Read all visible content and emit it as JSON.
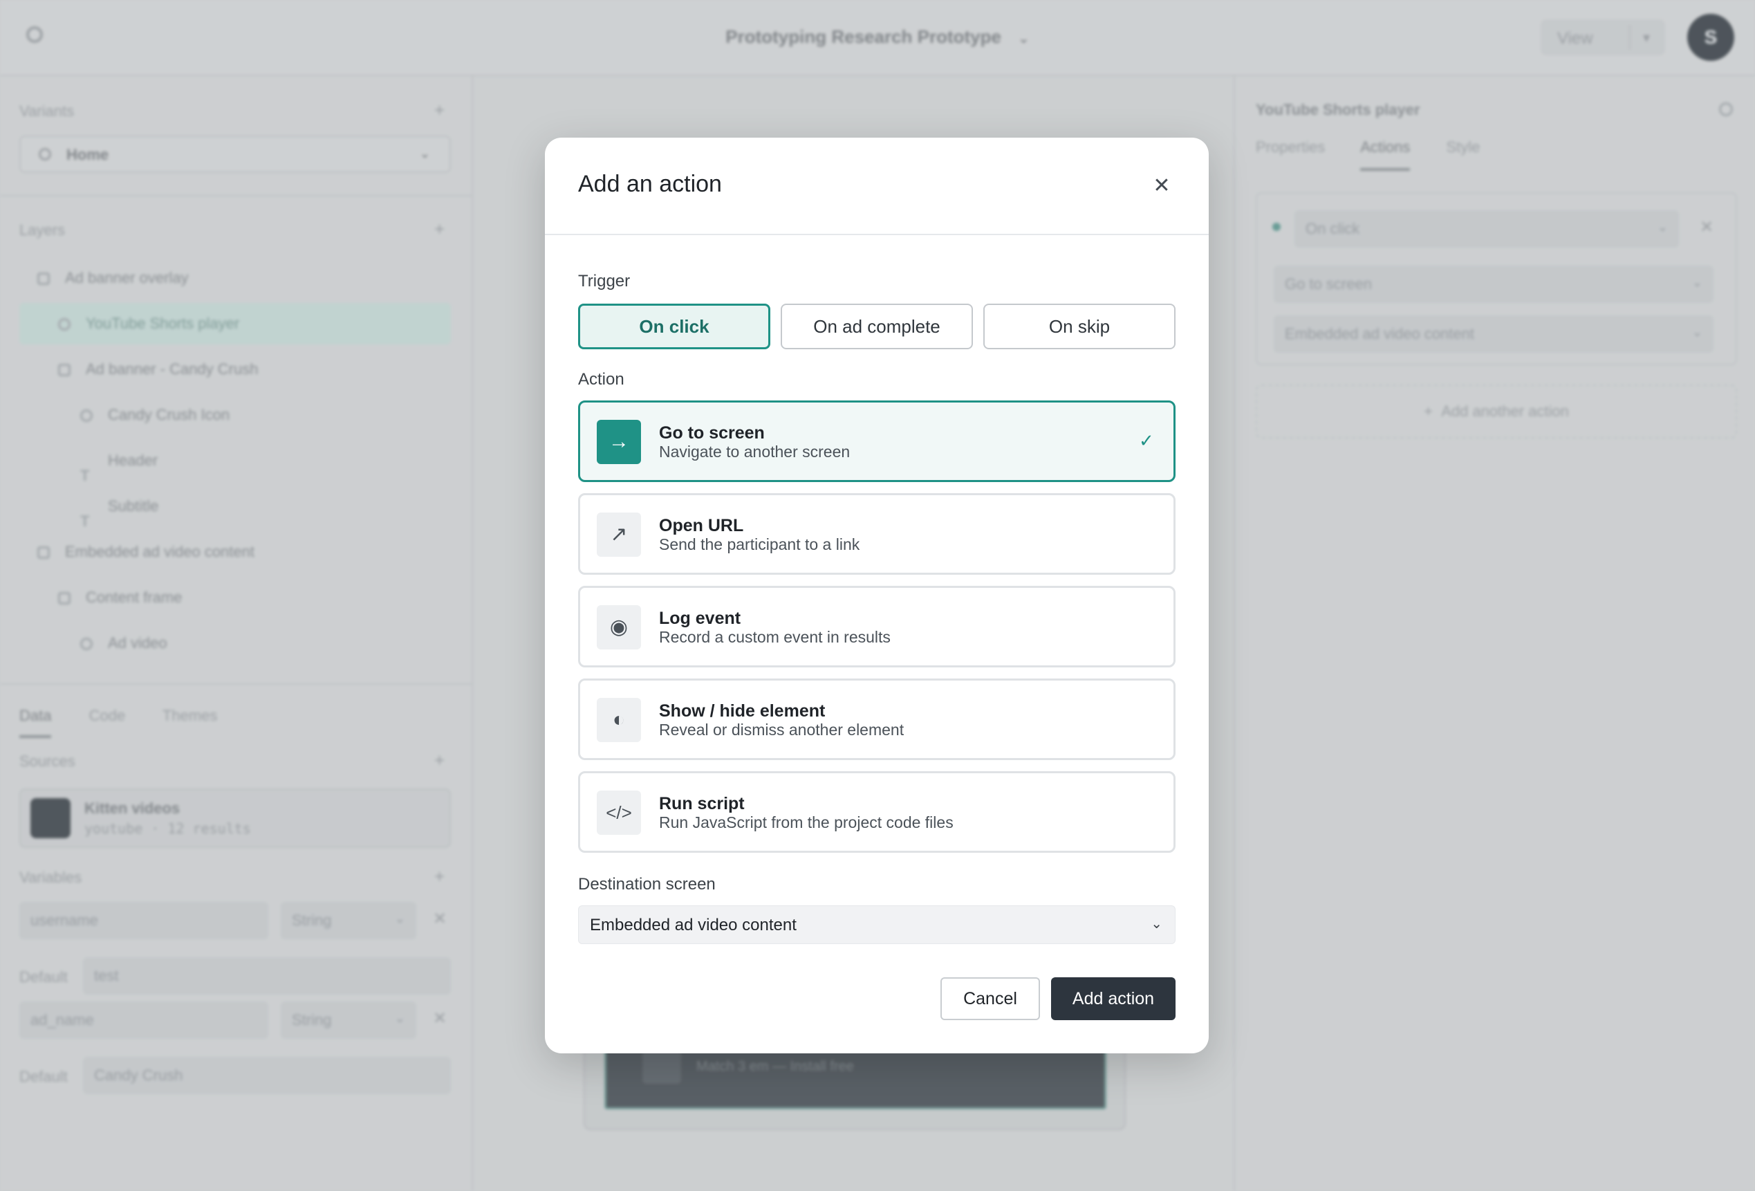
{
  "topbar": {
    "project_title": "Prototyping Research Prototype",
    "view_label": "View",
    "avatar_initial": "S"
  },
  "left_panel": {
    "variants_label": "Variants",
    "variant_selected": "Home",
    "layers_label": "Layers",
    "layers": [
      {
        "label": "Ad banner overlay"
      },
      {
        "label": "YouTube Shorts player"
      },
      {
        "label": "Ad banner - Candy Crush"
      },
      {
        "label": "Candy Crush Icon"
      },
      {
        "label": "Header"
      },
      {
        "label": "Subtitle"
      },
      {
        "label": "Embedded ad video content"
      },
      {
        "label": "Content frame"
      },
      {
        "label": "Ad video"
      }
    ],
    "tabs": [
      "Data",
      "Code",
      "Themes"
    ],
    "sources_label": "Sources",
    "source": {
      "name": "Kitten videos",
      "meta": "youtube · 12 results"
    },
    "variables_label": "Variables",
    "variables": [
      {
        "name": "username",
        "type": "String",
        "default_label": "Default",
        "default_value": "test"
      },
      {
        "name": "ad_name",
        "type": "String",
        "default_label": "Default",
        "default_value": "Candy Crush"
      }
    ]
  },
  "canvas": {
    "footer_text": "Match 3 em — Install free"
  },
  "right_panel": {
    "title": "YouTube Shorts player",
    "tabs": [
      "Properties",
      "Actions",
      "Style"
    ],
    "trigger_value": "On click",
    "action_value": "Go to screen",
    "destination_value": "Embedded ad video content",
    "add_another": "Add another action"
  },
  "modal": {
    "title": "Add an action",
    "close_icon": "close-icon",
    "trigger_label": "Trigger",
    "triggers": [
      "On click",
      "On ad complete",
      "On skip"
    ],
    "trigger_selected": "On click",
    "action_label": "Action",
    "actions": [
      {
        "name": "Go to screen",
        "desc": "Navigate to another screen",
        "icon": "arrow-right-icon",
        "glyph": "→",
        "selected": true
      },
      {
        "name": "Open URL",
        "desc": "Send the participant to a link",
        "icon": "arrow-up-right-icon",
        "glyph": "↗",
        "selected": false
      },
      {
        "name": "Log event",
        "desc": "Record a custom event in results",
        "icon": "radio-dot-icon",
        "glyph": "◉",
        "selected": false
      },
      {
        "name": "Show / hide element",
        "desc": "Reveal or dismiss another element",
        "icon": "half-circle-icon",
        "glyph": "◐",
        "selected": false
      },
      {
        "name": "Run script",
        "desc": "Run JavaScript from the project code files",
        "icon": "code-icon",
        "glyph": "</>",
        "selected": false
      }
    ],
    "destination_label": "Destination screen",
    "destination_value": "Embedded ad video content",
    "cancel_label": "Cancel",
    "submit_label": "Add action"
  },
  "colors": {
    "accent": "#1f9286",
    "primary_button": "#2d353e"
  }
}
